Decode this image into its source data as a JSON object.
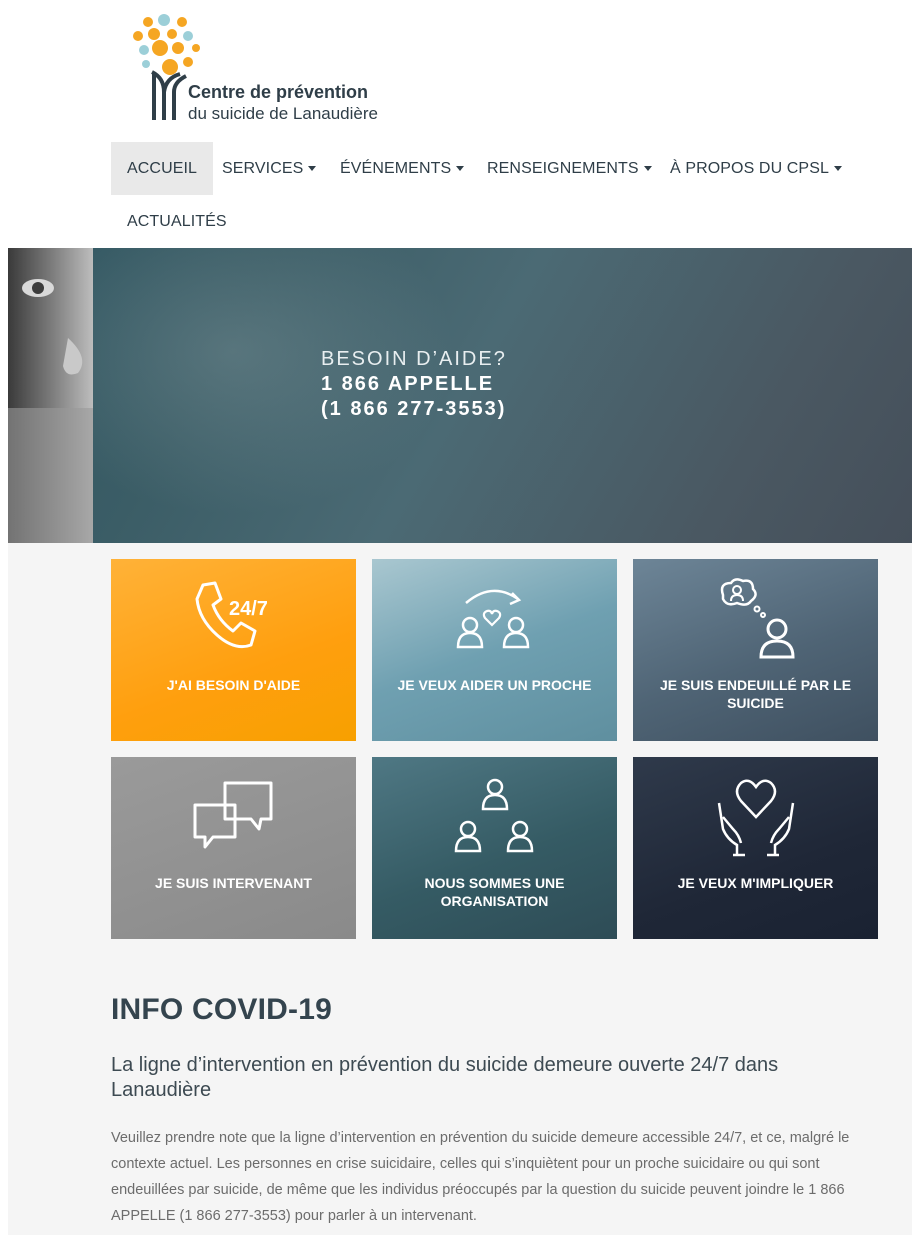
{
  "header": {
    "logo_title": "Centre de prévention",
    "logo_subtitle": "du suicide de Lanaudière"
  },
  "nav": {
    "items": [
      {
        "label": "ACCUEIL",
        "dropdown": false,
        "active": true
      },
      {
        "label": "SERVICES",
        "dropdown": true
      },
      {
        "label": "ÉVÉNEMENTS",
        "dropdown": true
      },
      {
        "label": "RENSEIGNEMENTS",
        "dropdown": true
      },
      {
        "label": "À PROPOS DU CPSL",
        "dropdown": true
      },
      {
        "label": "ACTUALITÉS",
        "dropdown": false
      }
    ]
  },
  "hero": {
    "line1": "BESOIN D’AIDE?",
    "line2": "1 866 APPELLE",
    "line3": "(1 866 277-3553)"
  },
  "tiles": [
    {
      "label": "J'AI BESOIN D'AIDE",
      "icon": "phone-24-7-icon",
      "badge": "24/7"
    },
    {
      "label": "JE VEUX AIDER UN PROCHE",
      "icon": "help-loved-one-icon"
    },
    {
      "label": "JE SUIS ENDEUILLÉ PAR LE SUICIDE",
      "icon": "grief-thought-icon"
    },
    {
      "label": "JE SUIS INTERVENANT",
      "icon": "chat-bubbles-icon"
    },
    {
      "label": "NOUS SOMMES UNE ORGANISATION",
      "icon": "group-icon"
    },
    {
      "label": "JE VEUX M'IMPLIQUER",
      "icon": "hands-heart-icon"
    }
  ],
  "covid": {
    "heading": "INFO COVID-19",
    "subheading": "La ligne d’intervention en prévention du suicide demeure ouverte 24/7 dans Lanaudière",
    "paragraph": "Veuillez prendre note que la ligne d’intervention en prévention du suicide demeure accessible 24/7, et ce, malgré le contexte actuel. Les personnes en crise suicidaire, celles qui s’inquiètent pour un proche suicidaire ou qui sont endeuillées par suicide, de même que les individus préoccupés par la question du suicide peuvent joindre le 1 866 APPELLE (1 866 277-3553) pour parler à un intervenant."
  },
  "colors": {
    "orange_tile": "#ffa20f",
    "nav_text": "#2f3e48",
    "content_bg": "#f5f5f5"
  }
}
